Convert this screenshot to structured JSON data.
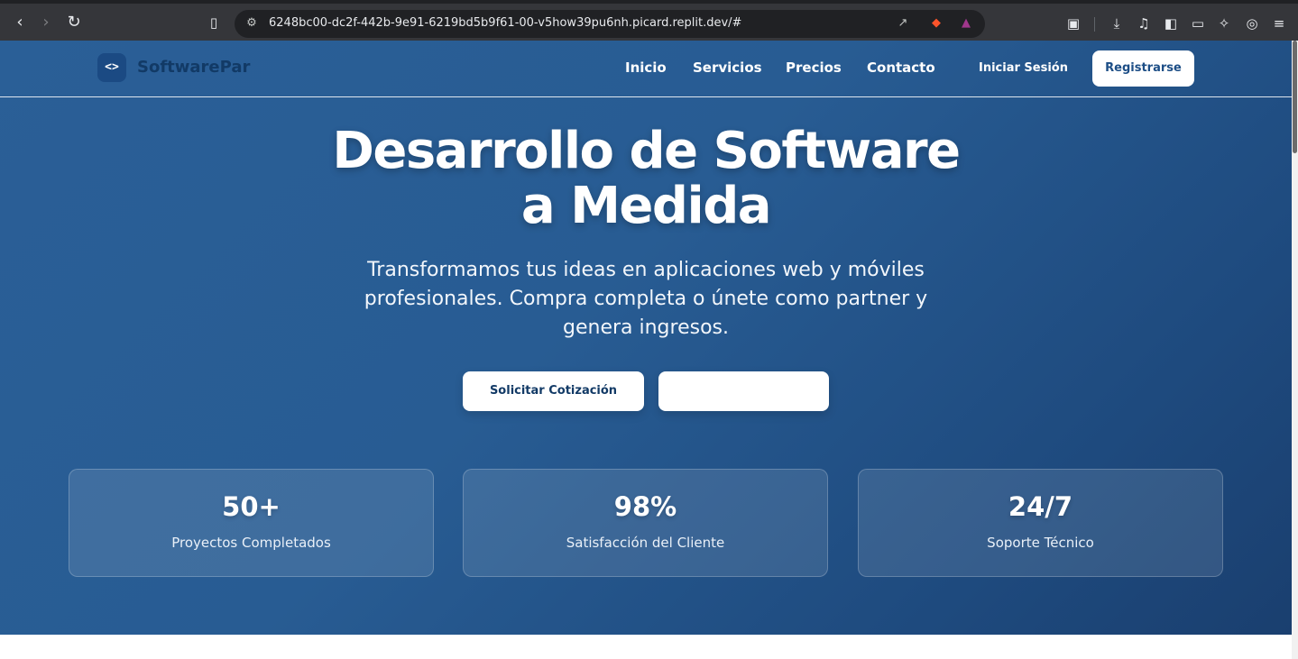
{
  "browser": {
    "url": "6248bc00-dc2f-442b-9e91-6219bd5b9f61-00-v5how39pu6nh.picard.replit.dev/#",
    "icons": [
      "back-icon",
      "forward-icon",
      "reload-icon",
      "bookmark-icon",
      "site-info-icon",
      "share-icon",
      "brave-shields-icon",
      "rewards-icon",
      "reader-mode-icon",
      "downloads-icon",
      "media-icon",
      "sidebar-icon",
      "wallet-icon",
      "leo-ai-icon",
      "vpn-icon",
      "menu-icon"
    ]
  },
  "site": {
    "logo_glyph": "<>",
    "name": "SoftwarePar",
    "nav": {
      "inicio": "Inicio",
      "servicios": "Servicios",
      "precios": "Precios",
      "contacto": "Contacto"
    },
    "login": "Iniciar Sesión",
    "register": "Registrarse"
  },
  "hero": {
    "title_line1": "Desarrollo de Software",
    "title_line2": "a Medida",
    "subtitle_line1": "Transformamos tus ideas en aplicaciones web y móviles",
    "subtitle_line2": "profesionales. Compra completa o únete como partner y",
    "subtitle_line3": "genera ingresos.",
    "cta_primary": "Solicitar Cotización",
    "cta_secondary": ""
  },
  "stats": [
    {
      "value": "50+",
      "label": "Proyectos Completados"
    },
    {
      "value": "98%",
      "label": "Satisfacción del Cliente"
    },
    {
      "value": "24/7",
      "label": "Soporte Técnico"
    }
  ],
  "colors": {
    "hero_gradient_start": "#2a5f97",
    "hero_gradient_end": "#1a3f6f",
    "logo_text": "#123a66",
    "button_text": "#1d4e86",
    "browser_bar": "#35363a",
    "url_field": "#202124"
  }
}
